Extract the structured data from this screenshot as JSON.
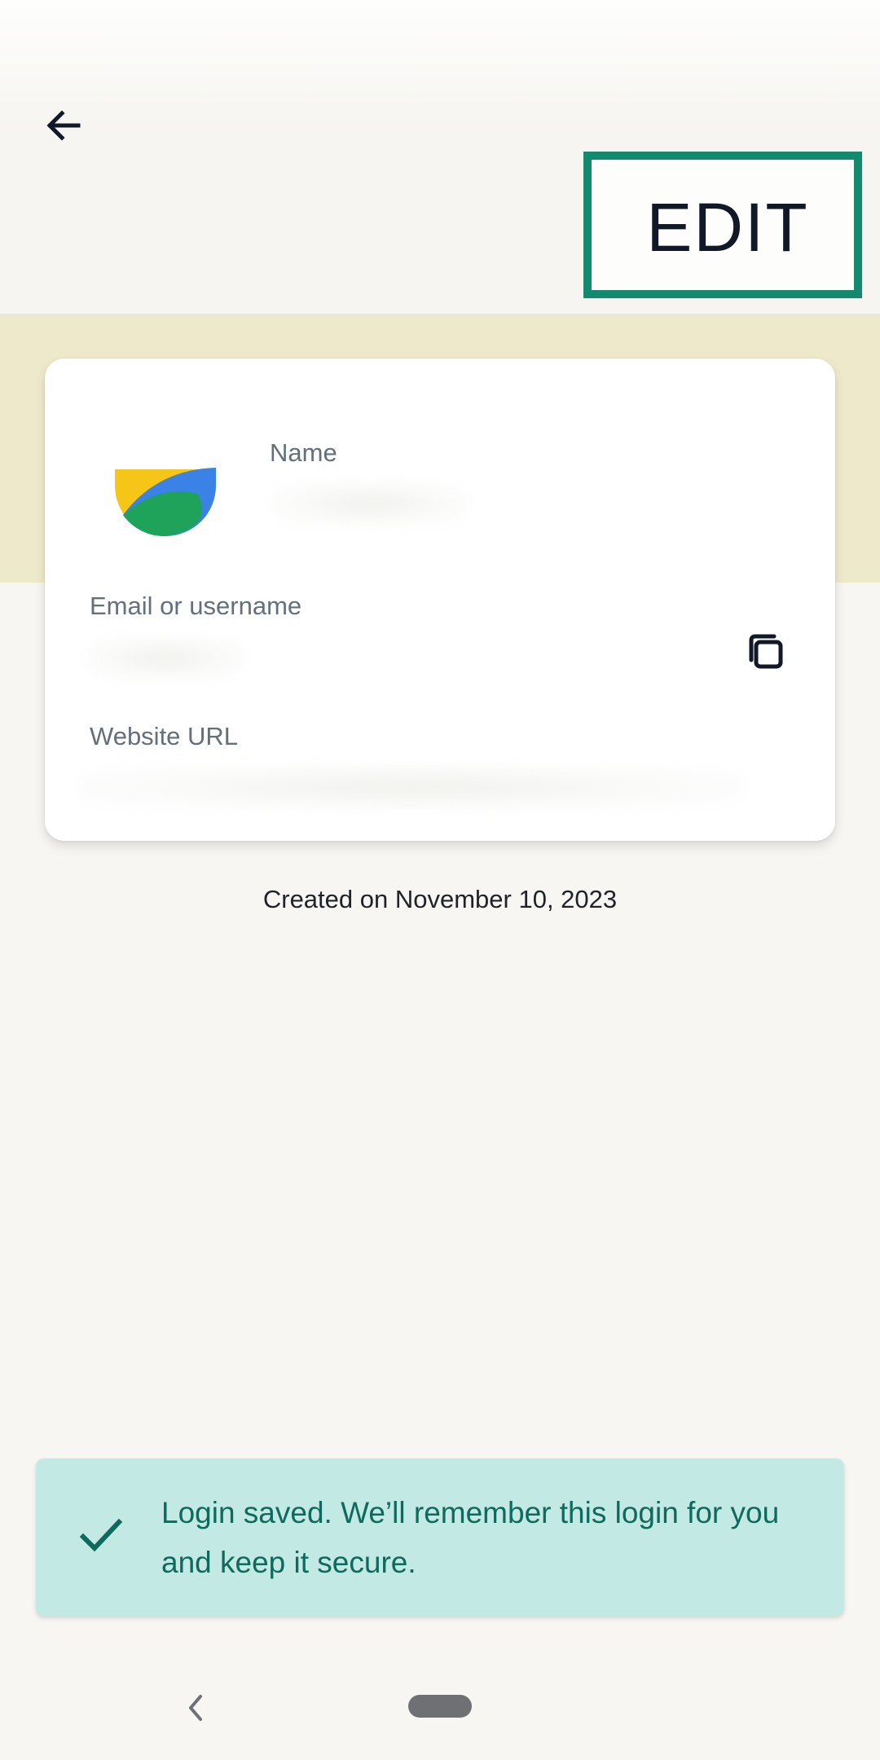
{
  "header": {
    "back_icon": "arrow-left-icon",
    "edit_label": "EDIT"
  },
  "card": {
    "logo_icon": "app-logo",
    "name_label": "Name",
    "name_value": "",
    "email_label": "Email or username",
    "email_value": "",
    "copy_icon": "copy-icon",
    "url_label": "Website URL",
    "url_value": ""
  },
  "created_text": "Created on November 10, 2023",
  "snackbar": {
    "icon": "check-icon",
    "message": "Login saved. We’ll remember this login for you and keep it secure."
  },
  "nav": {
    "back_icon": "chevron-left-icon",
    "home_icon": "home-pill"
  },
  "colors": {
    "accent": "#138a6d",
    "band": "#efe9cc",
    "snackbar_bg": "#c2e9e3",
    "snackbar_text": "#0e6a5c",
    "background": "#f7f6f2"
  }
}
